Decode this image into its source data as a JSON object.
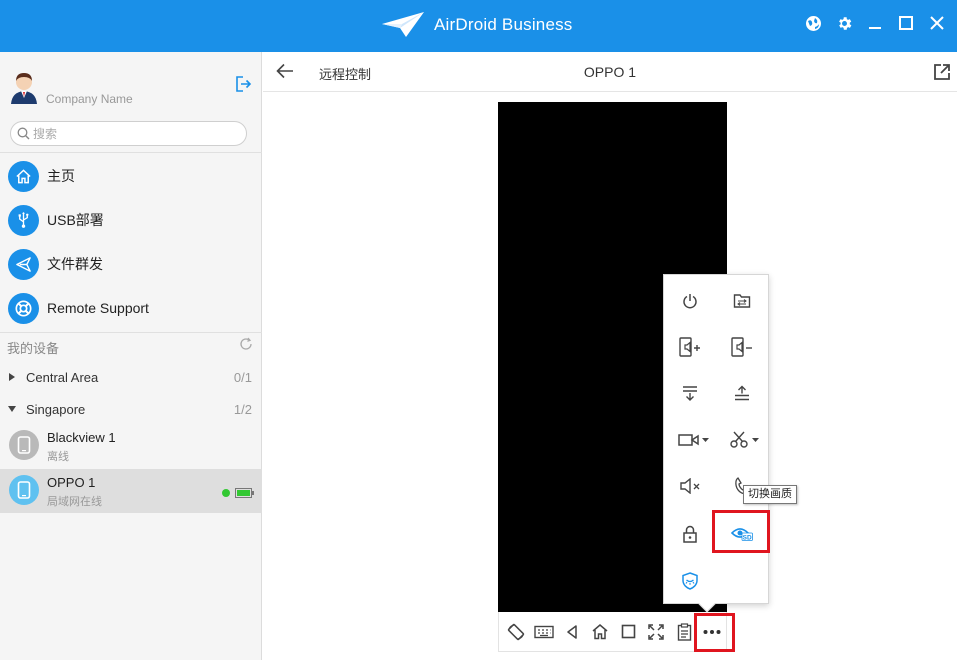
{
  "app": {
    "title": "AirDroid Business",
    "brand_color": "#1a90e8"
  },
  "window_controls": [
    "globe-icon",
    "gear-icon",
    "minimize-icon",
    "maximize-icon",
    "close-icon"
  ],
  "sidebar": {
    "company": "Company Name",
    "search_placeholder": "搜索",
    "nav": [
      {
        "label": "主页",
        "icon": "home-icon"
      },
      {
        "label": "USB部署",
        "icon": "usb-icon"
      },
      {
        "label": "文件群发",
        "icon": "send-icon"
      },
      {
        "label": "Remote Support",
        "icon": "lifebuoy-icon"
      }
    ],
    "devices_title": "我的设备",
    "groups": [
      {
        "name": "Central Area",
        "count": "0/1",
        "expanded": false
      },
      {
        "name": "Singapore",
        "count": "1/2",
        "expanded": true
      }
    ],
    "devices": [
      {
        "name": "Blackview 1",
        "status": "离线",
        "online": false
      },
      {
        "name": "OPPO 1",
        "status": "局域网在线",
        "online": true,
        "selected": true
      }
    ]
  },
  "main": {
    "title": "远程控制",
    "device_name": "OPPO 1",
    "toolbar": [
      "rotate-icon",
      "keyboard-icon",
      "back-icon",
      "home-icon",
      "recents-icon",
      "fullscreen-icon",
      "clipboard-icon",
      "more-icon"
    ],
    "popup": {
      "items": [
        "power-icon",
        "file-icon",
        "volume-up-icon",
        "volume-down-icon",
        "pull-down-icon",
        "push-up-icon",
        "record-icon",
        "screenshot-icon",
        "mute-icon",
        "phone-icon",
        "lock-icon",
        "quality-icon",
        "shield-icon"
      ],
      "quality_badge": "SD",
      "tooltip": "切换画质"
    }
  }
}
